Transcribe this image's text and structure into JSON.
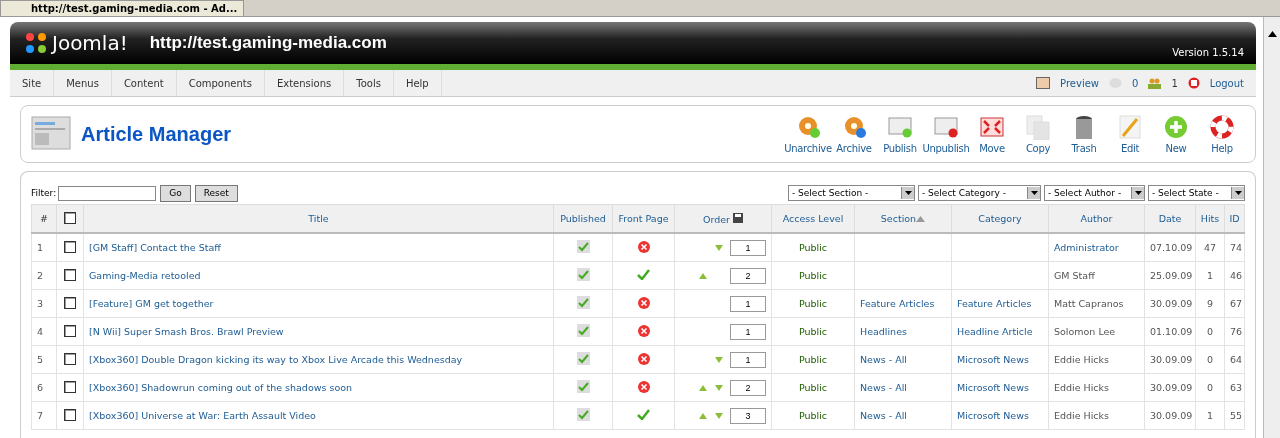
{
  "browser_tab": {
    "title": "http://test.gaming-media.com - Ad..."
  },
  "header": {
    "logo": "Joomla!",
    "site_url": "http://test.gaming-media.com",
    "version": "Version 1.5.14"
  },
  "menu": [
    "Site",
    "Menus",
    "Content",
    "Components",
    "Extensions",
    "Tools",
    "Help"
  ],
  "status": {
    "preview": "Preview",
    "messages": "0",
    "users": "1",
    "logout": "Logout"
  },
  "toolbar": {
    "title": "Article Manager",
    "buttons": [
      {
        "label": "Unarchive",
        "kind": "unarchive"
      },
      {
        "label": "Archive",
        "kind": "archive"
      },
      {
        "label": "Publish",
        "kind": "publish"
      },
      {
        "label": "Unpublish",
        "kind": "unpublish"
      },
      {
        "label": "Move",
        "kind": "move"
      },
      {
        "label": "Copy",
        "kind": "copy"
      },
      {
        "label": "Trash",
        "kind": "trash"
      },
      {
        "label": "Edit",
        "kind": "edit"
      },
      {
        "label": "New",
        "kind": "new"
      },
      {
        "label": "Help",
        "kind": "help"
      }
    ]
  },
  "filter": {
    "label": "Filter:",
    "go": "Go",
    "reset": "Reset",
    "selects": [
      "- Select Section -",
      "- Select Category -",
      "- Select Author -",
      "- Select State -"
    ]
  },
  "table": {
    "select_all_checked": false,
    "columns": [
      "#",
      "Title",
      "Published",
      "Front Page",
      "Order",
      "Access Level",
      "Section",
      "Category",
      "Author",
      "Date",
      "Hits",
      "ID"
    ],
    "rows": [
      {
        "num": "1",
        "checked": false,
        "title": "[GM Staff] Contact the Staff",
        "published": true,
        "front_page": false,
        "up": false,
        "down": true,
        "order": "1",
        "access": "Public",
        "section": "",
        "category": "",
        "author": "Administrator",
        "author_link": true,
        "date": "07.10.09",
        "hits": "47",
        "id": "74"
      },
      {
        "num": "2",
        "checked": false,
        "title": "Gaming-Media retooled",
        "published": true,
        "front_page": true,
        "up": true,
        "down": false,
        "order": "2",
        "access": "Public",
        "section": "",
        "category": "",
        "author": "GM Staff",
        "author_link": false,
        "date": "25.09.09",
        "hits": "1",
        "id": "46"
      },
      {
        "num": "3",
        "checked": false,
        "title": "[Feature] GM get together",
        "published": true,
        "front_page": false,
        "up": false,
        "down": false,
        "order": "1",
        "access": "Public",
        "section": "Feature Articles",
        "category": "Feature Articles",
        "author": "Matt Capranos",
        "author_link": false,
        "date": "30.09.09",
        "hits": "9",
        "id": "67"
      },
      {
        "num": "4",
        "checked": false,
        "title": "[N Wii] Super Smash Bros. Brawl Preview",
        "published": true,
        "front_page": false,
        "up": false,
        "down": false,
        "order": "1",
        "access": "Public",
        "section": "Headlines",
        "category": "Headline Article",
        "author": "Solomon Lee",
        "author_link": false,
        "date": "01.10.09",
        "hits": "0",
        "id": "76"
      },
      {
        "num": "5",
        "checked": false,
        "title": "[Xbox360] Double Dragon kicking its way to Xbox Live Arcade this Wednesday",
        "published": true,
        "front_page": false,
        "up": false,
        "down": true,
        "order": "1",
        "access": "Public",
        "section": "News - All",
        "category": "Microsoft News",
        "author": "Eddie Hicks",
        "author_link": false,
        "date": "30.09.09",
        "hits": "0",
        "id": "64"
      },
      {
        "num": "6",
        "checked": false,
        "title": "[Xbox360] Shadowrun coming out of the shadows soon",
        "published": true,
        "front_page": false,
        "up": true,
        "down": true,
        "order": "2",
        "access": "Public",
        "section": "News - All",
        "category": "Microsoft News",
        "author": "Eddie Hicks",
        "author_link": false,
        "date": "30.09.09",
        "hits": "0",
        "id": "63"
      },
      {
        "num": "7",
        "checked": false,
        "title": "[Xbox360] Universe at War: Earth Assault Video",
        "published": true,
        "front_page": true,
        "up": true,
        "down": true,
        "order": "3",
        "access": "Public",
        "section": "News - All",
        "category": "Microsoft News",
        "author": "Eddie Hicks",
        "author_link": false,
        "date": "30.09.09",
        "hits": "1",
        "id": "55"
      }
    ]
  }
}
